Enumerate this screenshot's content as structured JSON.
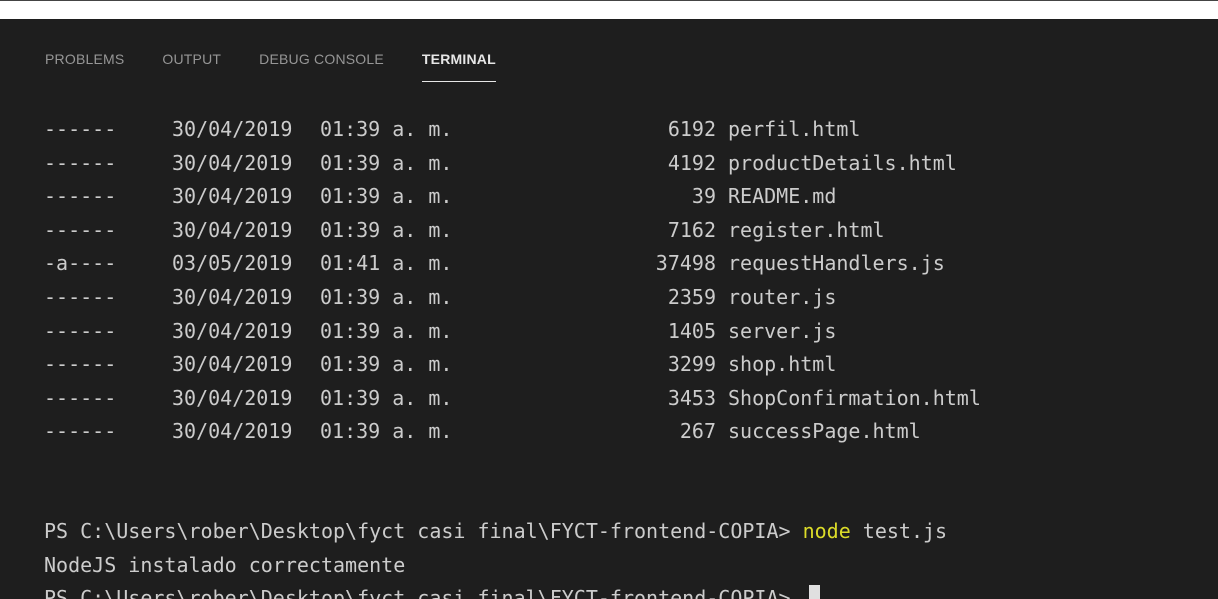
{
  "tabs": [
    {
      "label": "PROBLEMS",
      "active": false
    },
    {
      "label": "OUTPUT",
      "active": false
    },
    {
      "label": "DEBUG CONSOLE",
      "active": false
    },
    {
      "label": "TERMINAL",
      "active": true
    }
  ],
  "listing": [
    {
      "mode": "------",
      "date": "30/04/2019",
      "time": "01:39 a. m.",
      "length": "6192",
      "name": "perfil.html"
    },
    {
      "mode": "------",
      "date": "30/04/2019",
      "time": "01:39 a. m.",
      "length": "4192",
      "name": "productDetails.html"
    },
    {
      "mode": "------",
      "date": "30/04/2019",
      "time": "01:39 a. m.",
      "length": "39",
      "name": "README.md"
    },
    {
      "mode": "------",
      "date": "30/04/2019",
      "time": "01:39 a. m.",
      "length": "7162",
      "name": "register.html"
    },
    {
      "mode": "-a----",
      "date": "03/05/2019",
      "time": "01:41 a. m.",
      "length": "37498",
      "name": "requestHandlers.js"
    },
    {
      "mode": "------",
      "date": "30/04/2019",
      "time": "01:39 a. m.",
      "length": "2359",
      "name": "router.js"
    },
    {
      "mode": "------",
      "date": "30/04/2019",
      "time": "01:39 a. m.",
      "length": "1405",
      "name": "server.js"
    },
    {
      "mode": "------",
      "date": "30/04/2019",
      "time": "01:39 a. m.",
      "length": "3299",
      "name": "shop.html"
    },
    {
      "mode": "------",
      "date": "30/04/2019",
      "time": "01:39 a. m.",
      "length": "3453",
      "name": "ShopConfirmation.html"
    },
    {
      "mode": "------",
      "date": "30/04/2019",
      "time": "01:39 a. m.",
      "length": "267",
      "name": "successPage.html"
    }
  ],
  "prompt": "PS C:\\Users\\rober\\Desktop\\fyct casi final\\FYCT-frontend-COPIA> ",
  "command": {
    "program": "node",
    "args": " test.js"
  },
  "output": "NodeJS instalado correctamente",
  "colors": {
    "background": "#1e1e1e",
    "text": "#cccccc",
    "command_highlight": "#dcdc29",
    "tab_inactive": "#969696",
    "tab_active": "#e7e7e7"
  }
}
